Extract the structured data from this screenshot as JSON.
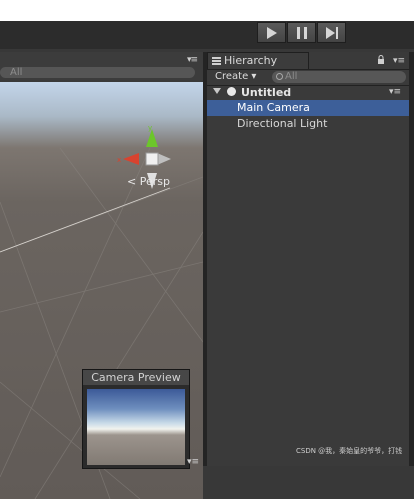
{
  "toolbar": {
    "play_icon": "play-icon",
    "pause_icon": "pause-icon",
    "step_icon": "step-icon"
  },
  "scene": {
    "search_placeholder": "All",
    "menu_icon": "menu-icon",
    "persp_label": "Persp",
    "gizmo_labels": {
      "y": "y",
      "x": "x"
    },
    "camera_preview": {
      "title": "Camera Preview"
    }
  },
  "hierarchy": {
    "tab_label": "Hierarchy",
    "create_label": "Create",
    "search_placeholder": "All",
    "scene_name": "Untitled",
    "items": [
      {
        "label": "Main Camera",
        "selected": true
      },
      {
        "label": "Directional Light",
        "selected": false
      }
    ]
  },
  "watermark": "CSDN @我，秦始皇的爷爷，打钱",
  "colors": {
    "selection": "#3d5f99",
    "panel_bg": "#3a3a3a",
    "gizmo_x": "#d8432f",
    "gizmo_y": "#6cc62a"
  }
}
